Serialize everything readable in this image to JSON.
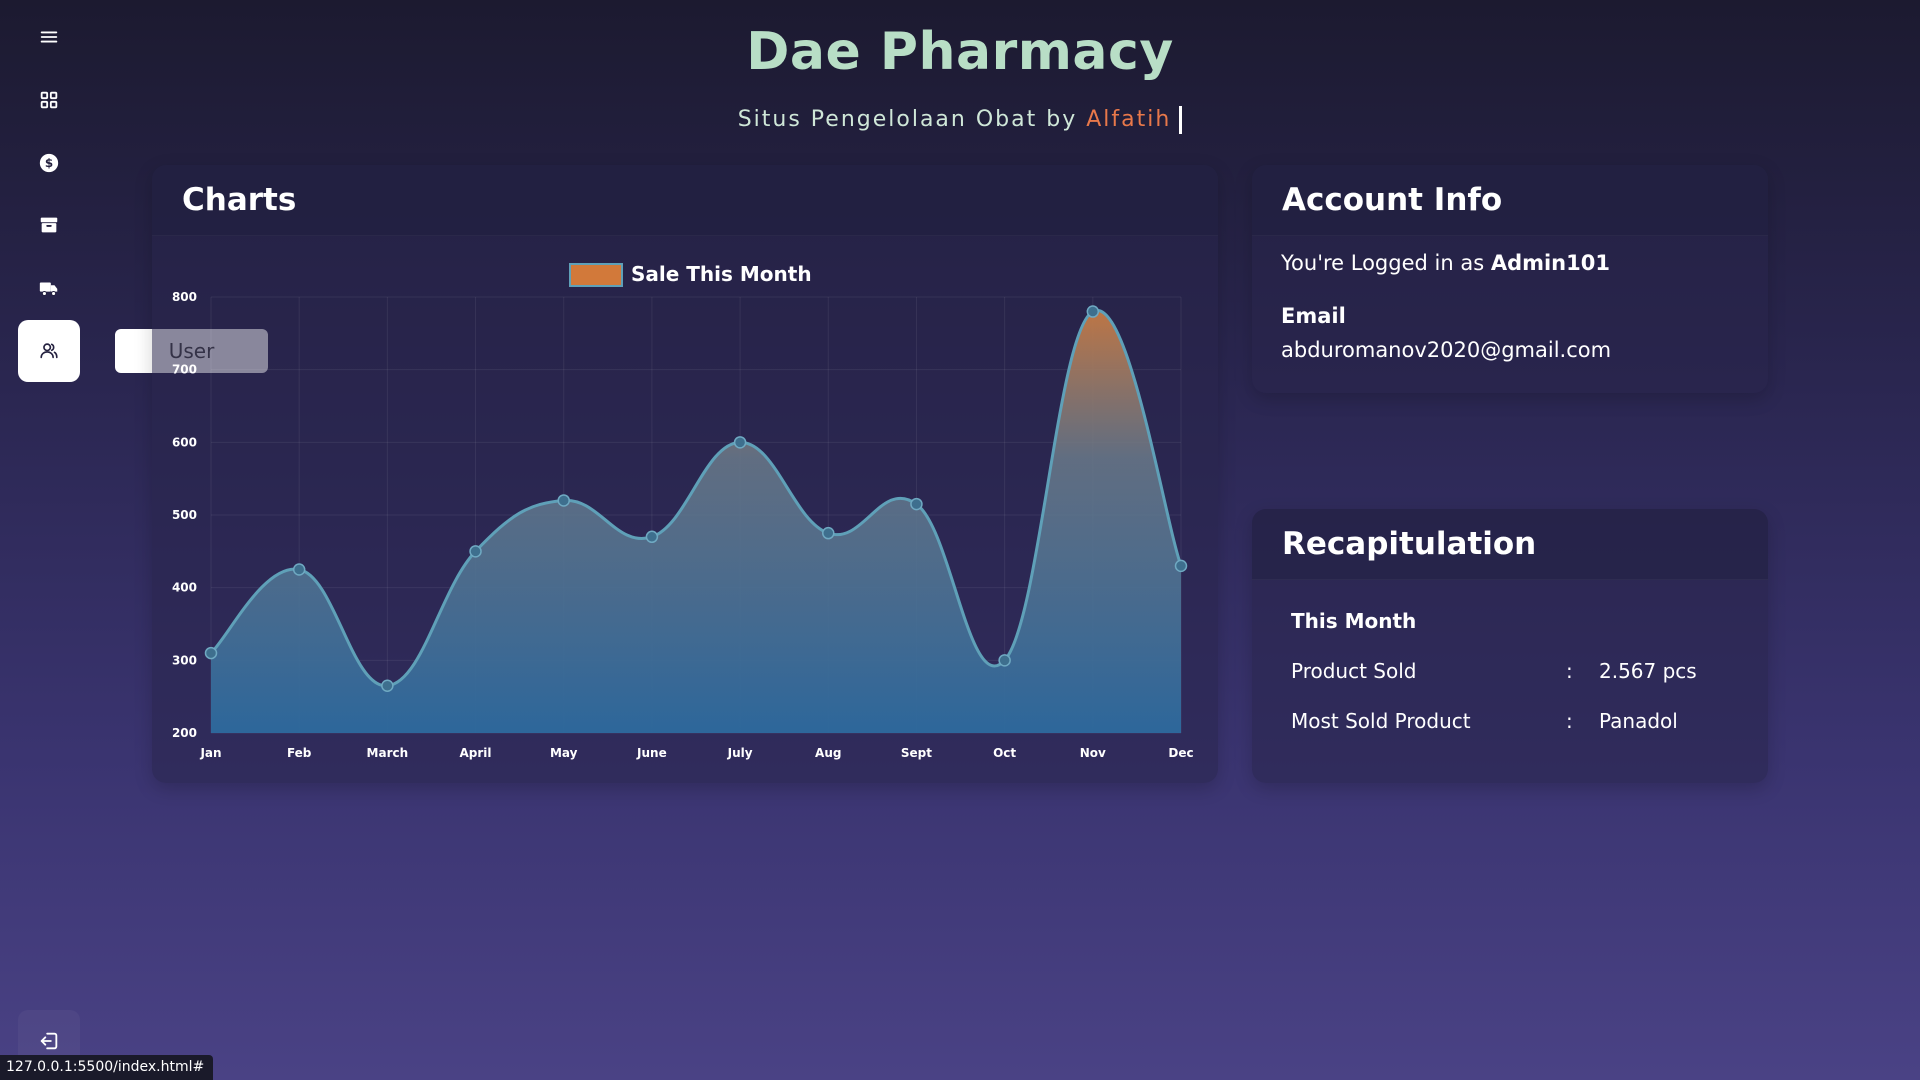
{
  "header": {
    "title": "Dae Pharmacy",
    "subtitle_prefix": "Situs Pengelolaan Obat by ",
    "subtitle_author": "Alfatih"
  },
  "sidebar": {
    "items": [
      {
        "icon": "menu-icon"
      },
      {
        "icon": "dashboard-icon"
      },
      {
        "icon": "dollar-icon"
      },
      {
        "icon": "archive-icon"
      },
      {
        "icon": "truck-icon"
      },
      {
        "icon": "user-icon",
        "active": true
      }
    ],
    "tooltip": "User",
    "logout_icon": "logout-icon"
  },
  "status_bar": {
    "url": "127.0.0.1:5500/index.html#"
  },
  "charts": {
    "heading": "Charts"
  },
  "chart_data": {
    "type": "area",
    "categories": [
      "Jan",
      "Feb",
      "March",
      "April",
      "May",
      "June",
      "July",
      "Aug",
      "Sept",
      "Oct",
      "Nov",
      "Dec"
    ],
    "series": [
      {
        "name": "Sale This Month",
        "values": [
          310,
          425,
          265,
          450,
          520,
          470,
          600,
          475,
          515,
          300,
          780,
          430
        ]
      }
    ],
    "ylim": [
      200,
      800
    ],
    "yticks": [
      200,
      300,
      400,
      500,
      600,
      700,
      800
    ],
    "grid": true,
    "legend_position": "top-center",
    "colors": {
      "line": "#5fa0b8",
      "fill_top": "#c57a45",
      "fill_bottom": "#2d6a9e",
      "legend": "#d2793a"
    }
  },
  "account": {
    "heading": "Account Info",
    "logged_prefix": "You're Logged in as ",
    "username": "Admin101",
    "email_label": "Email",
    "email": "abduromanov2020@gmail.com"
  },
  "recap": {
    "heading": "Recapitulation",
    "period": "This Month",
    "rows": [
      {
        "label": "Product Sold",
        "sep": ":",
        "value": "2.567 pcs"
      },
      {
        "label": "Most Sold Product",
        "sep": ":",
        "value": "Panadol"
      }
    ]
  }
}
